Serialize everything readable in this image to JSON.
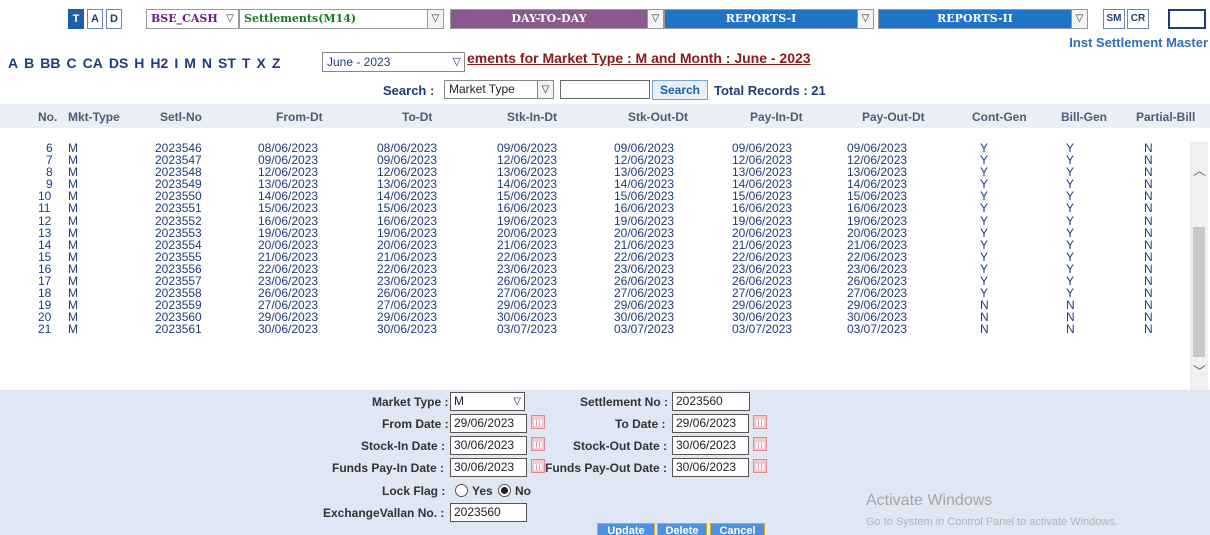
{
  "toolbar": {
    "t_label": "T",
    "a_label": "A",
    "d_label": "D",
    "segment": "BSE_CASH",
    "settlement_menu": "Settlements(M14)",
    "day_to_day": "DAY-TO-DAY",
    "reports1": "REPORTS-I",
    "reports2": "REPORTS-II",
    "sm_label": "SM",
    "cr_label": "CR"
  },
  "inst_link": "Inst Settlement Master",
  "alphabet": [
    "A",
    "B",
    "BB",
    "C",
    "CA",
    "DS",
    "H",
    "H2",
    "I",
    "M",
    "N",
    "ST",
    "T",
    "X",
    "Z"
  ],
  "month_select": "June - 2023",
  "page_title": "ements for Market Type : M and Month : June - 2023",
  "search": {
    "label": "Search :",
    "type": "Market Type",
    "value": "",
    "button": "Search"
  },
  "total": "Total Records : 21",
  "columns": [
    "No.",
    "Mkt-Type",
    "Setl-No",
    "From-Dt",
    "To-Dt",
    "Stk-In-Dt",
    "Stk-Out-Dt",
    "Pay-In-Dt",
    "Pay-Out-Dt",
    "Cont-Gen",
    "Bill-Gen",
    "Partial-Bill"
  ],
  "rows": [
    [
      "6",
      "M",
      "2023546",
      "08/06/2023",
      "08/06/2023",
      "09/06/2023",
      "09/06/2023",
      "09/06/2023",
      "09/06/2023",
      "Y",
      "Y",
      "N"
    ],
    [
      "7",
      "M",
      "2023547",
      "09/06/2023",
      "09/06/2023",
      "12/06/2023",
      "12/06/2023",
      "12/06/2023",
      "12/06/2023",
      "Y",
      "Y",
      "N"
    ],
    [
      "8",
      "M",
      "2023548",
      "12/06/2023",
      "12/06/2023",
      "13/06/2023",
      "13/06/2023",
      "13/06/2023",
      "13/06/2023",
      "Y",
      "Y",
      "N"
    ],
    [
      "9",
      "M",
      "2023549",
      "13/06/2023",
      "13/06/2023",
      "14/06/2023",
      "14/06/2023",
      "14/06/2023",
      "14/06/2023",
      "Y",
      "Y",
      "N"
    ],
    [
      "10",
      "M",
      "2023550",
      "14/06/2023",
      "14/06/2023",
      "15/06/2023",
      "15/06/2023",
      "15/06/2023",
      "15/06/2023",
      "Y",
      "Y",
      "N"
    ],
    [
      "11",
      "M",
      "2023551",
      "15/06/2023",
      "15/06/2023",
      "16/06/2023",
      "16/06/2023",
      "16/06/2023",
      "16/06/2023",
      "Y",
      "Y",
      "N"
    ],
    [
      "12",
      "M",
      "2023552",
      "16/06/2023",
      "16/06/2023",
      "19/06/2023",
      "19/06/2023",
      "19/06/2023",
      "19/06/2023",
      "Y",
      "Y",
      "N"
    ],
    [
      "13",
      "M",
      "2023553",
      "19/06/2023",
      "19/06/2023",
      "20/06/2023",
      "20/06/2023",
      "20/06/2023",
      "20/06/2023",
      "Y",
      "Y",
      "N"
    ],
    [
      "14",
      "M",
      "2023554",
      "20/06/2023",
      "20/06/2023",
      "21/06/2023",
      "21/06/2023",
      "21/06/2023",
      "21/06/2023",
      "Y",
      "Y",
      "N"
    ],
    [
      "15",
      "M",
      "2023555",
      "21/06/2023",
      "21/06/2023",
      "22/06/2023",
      "22/06/2023",
      "22/06/2023",
      "22/06/2023",
      "Y",
      "Y",
      "N"
    ],
    [
      "16",
      "M",
      "2023556",
      "22/06/2023",
      "22/06/2023",
      "23/06/2023",
      "23/06/2023",
      "23/06/2023",
      "23/06/2023",
      "Y",
      "Y",
      "N"
    ],
    [
      "17",
      "M",
      "2023557",
      "23/06/2023",
      "23/06/2023",
      "26/06/2023",
      "26/06/2023",
      "26/06/2023",
      "26/06/2023",
      "Y",
      "Y",
      "N"
    ],
    [
      "18",
      "M",
      "2023558",
      "26/06/2023",
      "26/06/2023",
      "27/06/2023",
      "27/06/2023",
      "27/06/2023",
      "27/06/2023",
      "Y",
      "Y",
      "N"
    ],
    [
      "19",
      "M",
      "2023559",
      "27/06/2023",
      "27/06/2023",
      "29/06/2023",
      "29/06/2023",
      "29/06/2023",
      "29/06/2023",
      "N",
      "N",
      "N"
    ],
    [
      "20",
      "M",
      "2023560",
      "29/06/2023",
      "29/06/2023",
      "30/06/2023",
      "30/06/2023",
      "30/06/2023",
      "30/06/2023",
      "N",
      "N",
      "N"
    ],
    [
      "21",
      "M",
      "2023561",
      "30/06/2023",
      "30/06/2023",
      "03/07/2023",
      "03/07/2023",
      "03/07/2023",
      "03/07/2023",
      "N",
      "N",
      "N"
    ]
  ],
  "form": {
    "market_type_label": "Market Type :",
    "market_type": "M",
    "settlement_no_label": "Settlement No :",
    "settlement_no": "2023560",
    "from_date_label": "From Date :",
    "from_date": "29/06/2023",
    "to_date_label": "To Date :",
    "to_date": "29/06/2023",
    "stock_in_label": "Stock-In Date :",
    "stock_in": "30/06/2023",
    "stock_out_label": "Stock-Out Date :",
    "stock_out": "30/06/2023",
    "funds_in_label": "Funds Pay-In Date :",
    "funds_in": "30/06/2023",
    "funds_out_label": "Funds Pay-Out Date :",
    "funds_out": "30/06/2023",
    "lock_flag_label": "Lock Flag :",
    "lock_yes": "Yes",
    "lock_no": "No",
    "lock_value": "No",
    "vallan_label": "ExchangeVallan No. :",
    "vallan": "2023560",
    "update": "Update",
    "delete": "Delete",
    "cancel": "Cancel"
  },
  "watermark": {
    "line1": "Activate Windows",
    "line2": "Go to System in Control Panel to activate Windows."
  },
  "colors": {
    "band": "#8a5a8e",
    "band_blue": "#1e74c8",
    "form_bg": "#dfe6f4",
    "title": "#8b1a1a"
  }
}
